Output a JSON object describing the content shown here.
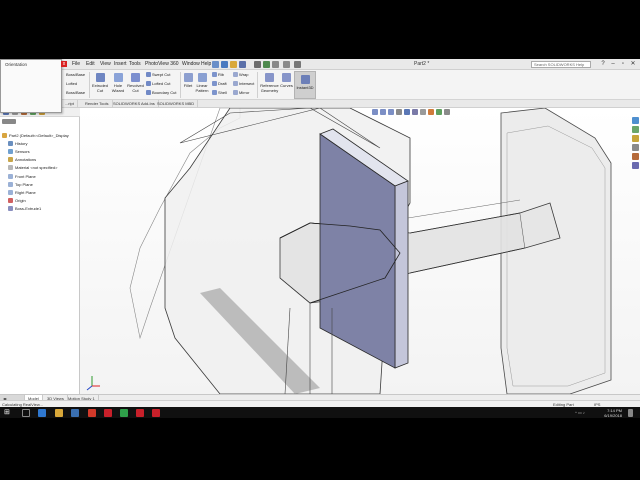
{
  "menus": [
    "File",
    "Edit",
    "View",
    "Insert",
    "Tools",
    "PhotoView 360",
    "Window",
    "Help"
  ],
  "window": {
    "title": "Part2 *",
    "search_placeholder": "Search SOLIDWORKS Help"
  },
  "orientation_popup": {
    "title": "Orientation",
    "close_label": "x"
  },
  "ribbon": {
    "left_partial": [
      "Boss/Base",
      "Lofted",
      "Boss/Base"
    ],
    "extruded_cut": "Extruded Cut",
    "hole_wizard": "Hole Wizard",
    "revolved_cut": "Revolved Cut",
    "swept_cut": "Swept Cut",
    "lofted_cut": "Lofted Cut",
    "boundary_cut": "Boundary Cut",
    "fillet": "Fillet",
    "linear_pattern": "Linear Pattern",
    "rib": "Rib",
    "draft": "Draft",
    "shell": "Shell",
    "wrap": "Wrap",
    "intersect": "Intersect",
    "mirror": "Mirror",
    "reference_geometry": "Reference Geometry",
    "curves": "Curves",
    "instant3d": "Instant3D"
  },
  "command_tabs": [
    "...ript",
    "Render Tools",
    "SOLIDWORKS Add-Ins",
    "SOLIDWORKS MBD"
  ],
  "tree": {
    "root": "Part2 (Default<<Default>_Display",
    "items": [
      "History",
      "Sensors",
      "Annotations",
      "Material <not specified>",
      "Front Plane",
      "Top Plane",
      "Right Plane",
      "Origin",
      "Boss-Extrude1"
    ]
  },
  "bottom_tabs": [
    "Model",
    "3D Views",
    "Motion Study 1"
  ],
  "status": {
    "left": "Calculating RealView...",
    "mode": "Editing Part",
    "units": "IPS"
  },
  "taskbar": {
    "time": "7:14 PM",
    "date": "6/19/2018"
  },
  "colors": {
    "ribbon_bg": "#f4f4f4",
    "accent_red": "#d82020",
    "face_blue": "#7e82a6"
  }
}
